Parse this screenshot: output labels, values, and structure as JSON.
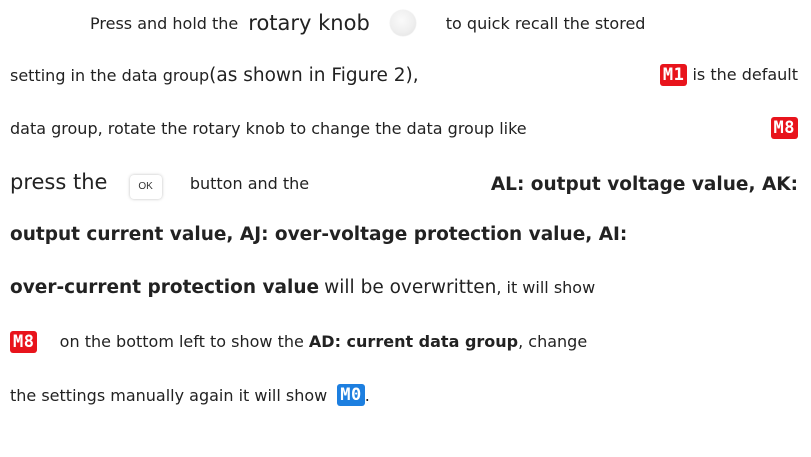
{
  "paragraph": {
    "l1_a": "Press and hold the",
    "l1_b": "rotary knob",
    "l1_c": "to quick recall the stored",
    "l2_a": "setting in the data group",
    "l2_b": "(as shown in Figure 2),",
    "l2_c": "is the default",
    "l3_a": "data group, rotate the rotary knob to change the data group like",
    "l4_a": "press the",
    "l4_b": "button and the",
    "l4_c": "AL: output voltage value, AK:",
    "l5_a": "output current value, AJ: over-voltage protection value, AI:",
    "l6_a": "over-current protection value",
    "l6_b": "will be overwritten",
    "l6_c": ", it will show",
    "l7_a": "on the bottom left to show the",
    "l7_b": "AD: current data group",
    "l7_c": ", change",
    "l8_a": "the settings manually again it will show",
    "l8_b": "."
  },
  "badges": {
    "m1": "M1",
    "m8": "M8",
    "m0": "M0"
  },
  "buttons": {
    "ok": "OK"
  },
  "colors": {
    "badge_red": "#e8141c",
    "badge_blue": "#1d7fe0"
  }
}
